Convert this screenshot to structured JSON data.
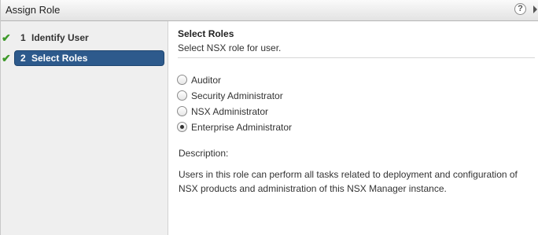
{
  "window": {
    "title": "Assign Role",
    "help_label": "?"
  },
  "wizard": {
    "steps": [
      {
        "number": "1",
        "label": "Identify User",
        "completed": true,
        "active": false
      },
      {
        "number": "2",
        "label": "Select Roles",
        "completed": true,
        "active": true
      }
    ],
    "check_icon": "✔"
  },
  "main": {
    "title": "Select Roles",
    "subtitle": "Select NSX role for user.",
    "roles": [
      {
        "label": "Auditor",
        "selected": false
      },
      {
        "label": "Security Administrator",
        "selected": false
      },
      {
        "label": "NSX Administrator",
        "selected": false
      },
      {
        "label": "Enterprise Administrator",
        "selected": true
      }
    ],
    "description_label": "Description:",
    "description_text": "Users in this role can perform all tasks related to deployment and configuration of NSX products and administration of this NSX Manager instance."
  },
  "colors": {
    "active_step_bg": "#2d5a8c",
    "check_green": "#3e9a2a",
    "sidebar_bg": "#efefef"
  }
}
